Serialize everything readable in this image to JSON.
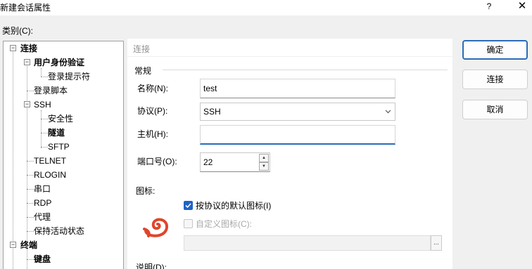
{
  "window": {
    "title": "新建会话属性",
    "help_label": "?",
    "close_label": "✕"
  },
  "category_label": "类别(C):",
  "tree": {
    "items": [
      {
        "label": "连接",
        "bold": true
      },
      {
        "label": "用户身份验证",
        "bold": true
      },
      {
        "label": "登录提示符",
        "bold": false
      },
      {
        "label": "登录脚本",
        "bold": false
      },
      {
        "label": "SSH",
        "bold": false
      },
      {
        "label": "安全性",
        "bold": false
      },
      {
        "label": "隧道",
        "bold": true
      },
      {
        "label": "SFTP",
        "bold": false
      },
      {
        "label": "TELNET",
        "bold": false
      },
      {
        "label": "RLOGIN",
        "bold": false
      },
      {
        "label": "串口",
        "bold": false
      },
      {
        "label": "RDP",
        "bold": false
      },
      {
        "label": "代理",
        "bold": false
      },
      {
        "label": "保持活动状态",
        "bold": false
      },
      {
        "label": "终端",
        "bold": true
      },
      {
        "label": "键盘",
        "bold": true
      }
    ]
  },
  "breadcrumb": "连接",
  "general": {
    "section_title": "常规",
    "name_label": "名称(N):",
    "name_value": "test",
    "protocol_label": "协议(P):",
    "protocol_value": "SSH",
    "host_label": "主机(H):",
    "host_value": "",
    "port_label": "端口号(O):",
    "port_value": "22"
  },
  "icon_section": {
    "label": "图标:",
    "default_icon_label": "按协议的默认图标(I)",
    "default_icon_checked": true,
    "custom_icon_label": "自定义图标(C):",
    "custom_icon_checked": false,
    "browse_label": "..."
  },
  "description_label": "说明(D):",
  "buttons": {
    "ok": "确定",
    "connect": "连接",
    "cancel": "取消"
  },
  "colors": {
    "accent": "#2a6cb8",
    "checkbox": "#2063c6",
    "logo": "#e0452b"
  }
}
